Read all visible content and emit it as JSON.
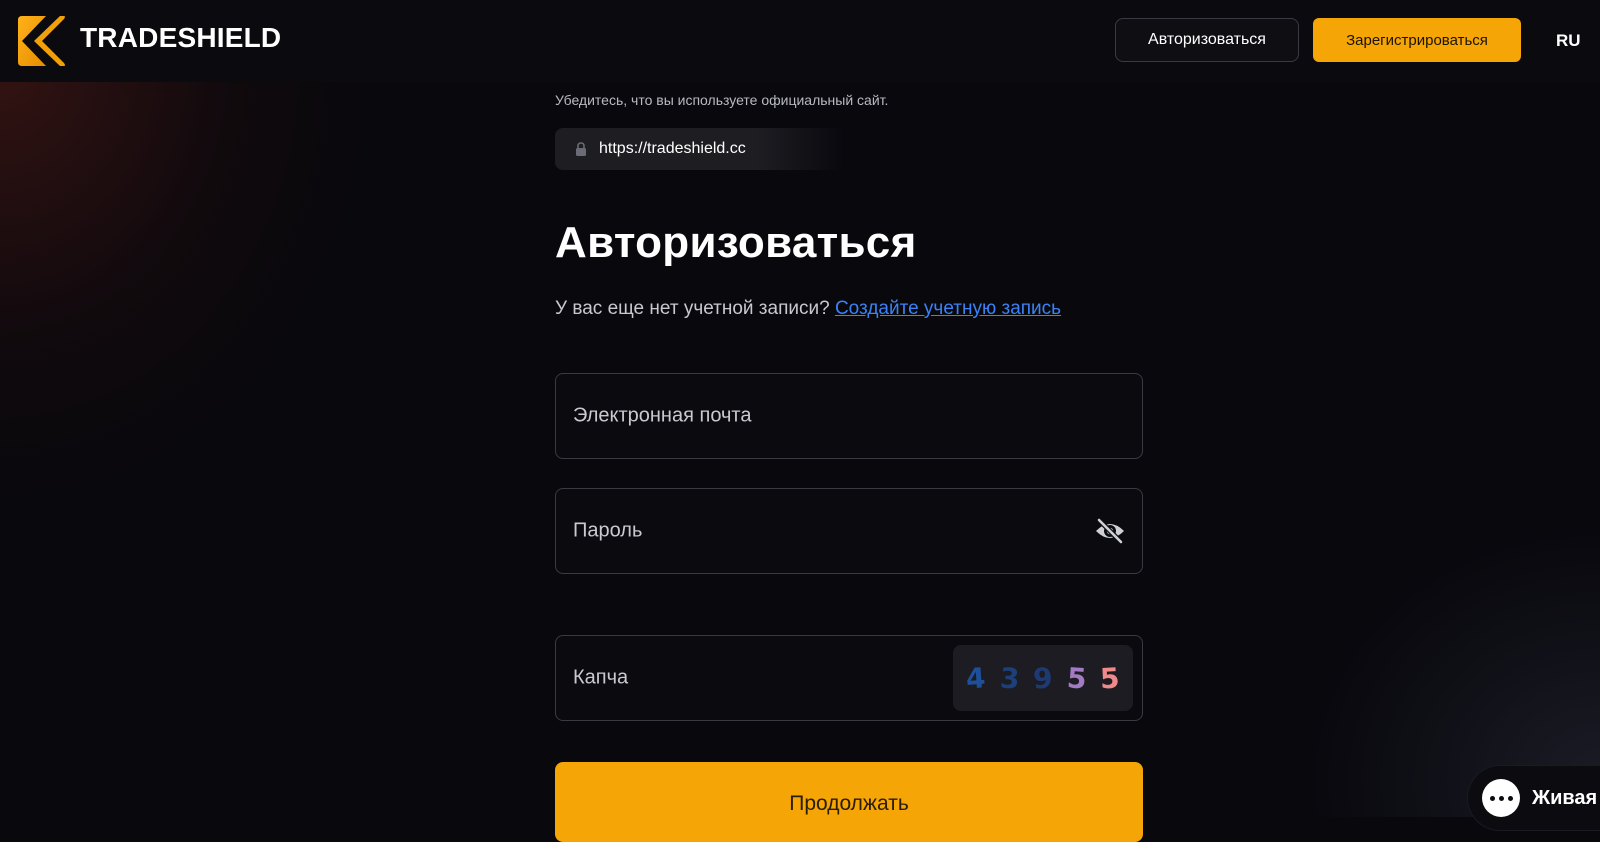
{
  "header": {
    "brand": "TRADESHIELD",
    "login_label": "Авторизоваться",
    "register_label": "Зарегистрироваться",
    "language": "RU"
  },
  "security": {
    "note": "Убедитесь, что вы используете официальный сайт.",
    "url": "https://tradeshield.cc",
    "icon": "lock-icon"
  },
  "form": {
    "title": "Авторизоваться",
    "signup_prompt": "У вас еще нет учетной записи?",
    "signup_link": "Создайте учетную запись",
    "email_placeholder": "Электронная почта",
    "password_placeholder": "Пароль",
    "password_toggle_icon": "eye-off-icon",
    "captcha_label": "Капча",
    "captcha_digits": [
      "4",
      "3",
      "9",
      "5",
      "5"
    ],
    "captcha_colors": [
      "#1e4f9a",
      "#1d3f7a",
      "#1d3a72",
      "#a27bc2",
      "#f08a8a"
    ],
    "submit_label": "Продолжать"
  },
  "chat": {
    "label": "Живая"
  },
  "colors": {
    "accent": "#f5a505",
    "link": "#3b82f6",
    "background": "#08080d"
  }
}
